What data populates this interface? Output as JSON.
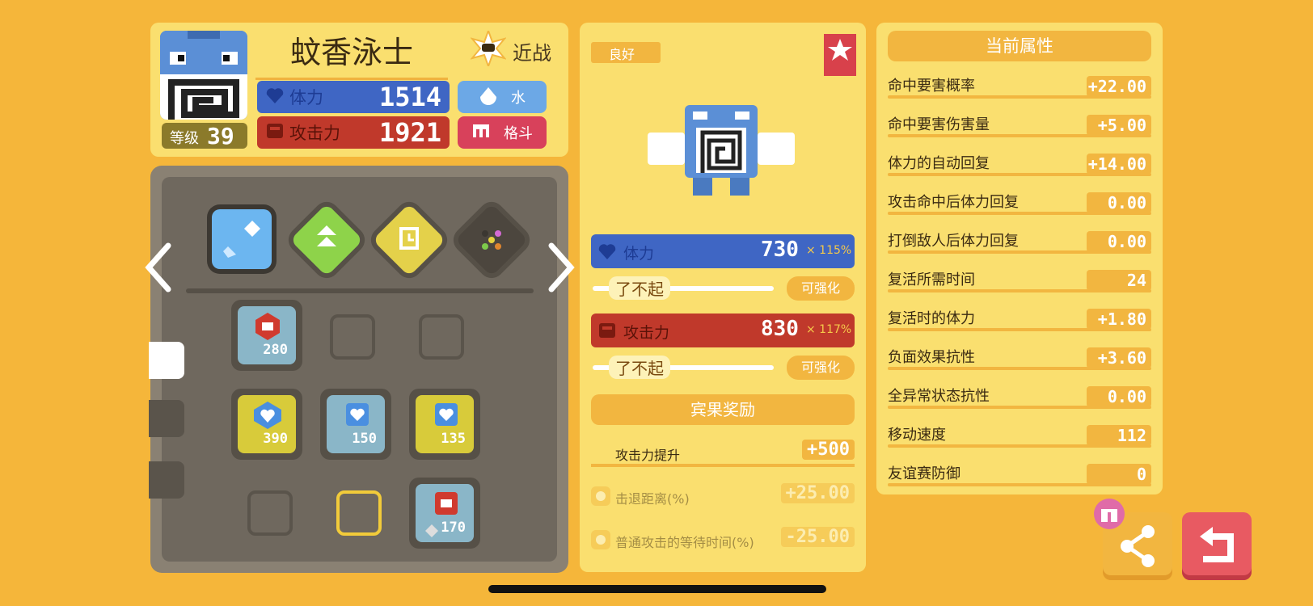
{
  "pokemon": {
    "name": "蚊香泳士",
    "level_label": "等级",
    "level": "39",
    "style_label": "近战",
    "hp_label": "体力",
    "hp_value": "1514",
    "atk_label": "攻击力",
    "atk_value": "1921",
    "types": [
      "水",
      "格斗"
    ]
  },
  "board": {
    "slots": [
      {
        "value": "280"
      },
      {
        "value": "390"
      },
      {
        "value": "150"
      },
      {
        "value": "135"
      },
      {
        "value": "170"
      }
    ]
  },
  "detail": {
    "quality_badge": "良好",
    "hp_label": "体力",
    "hp_value": "730",
    "hp_mult": "× 115%",
    "hp_grade": "了不起",
    "hp_upgrade": "可强化",
    "atk_label": "攻击力",
    "atk_value": "830",
    "atk_mult": "× 117%",
    "atk_grade": "了不起",
    "atk_upgrade": "可强化",
    "bonus_header": "宾果奖励",
    "bonus_rows": [
      {
        "label": "攻击力提升",
        "value": "+500",
        "active": true
      },
      {
        "label": "击退距离(%)",
        "value": "+25.00",
        "active": false
      },
      {
        "label": "普通攻击的等待时间(%)",
        "value": "-25.00",
        "active": false
      }
    ]
  },
  "attributes": {
    "header": "当前属性",
    "rows": [
      {
        "label": "命中要害概率",
        "value": "+22.00"
      },
      {
        "label": "命中要害伤害量",
        "value": "+5.00"
      },
      {
        "label": "体力的自动回复",
        "value": "+14.00"
      },
      {
        "label": "攻击命中后体力回复",
        "value": "0.00"
      },
      {
        "label": "打倒敌人后体力回复",
        "value": "0.00"
      },
      {
        "label": "复活所需时间",
        "value": "24"
      },
      {
        "label": "复活时的体力",
        "value": "+1.80"
      },
      {
        "label": "负面效果抗性",
        "value": "+3.60"
      },
      {
        "label": "全异常状态抗性",
        "value": "0.00"
      },
      {
        "label": "移动速度",
        "value": "112"
      },
      {
        "label": "友谊赛防御",
        "value": "0"
      }
    ]
  },
  "colors": {
    "background": "#F5B63A",
    "panel": "#FADF6F",
    "hp_blue": "#3F66C4",
    "atk_red": "#C0392B",
    "water": "#6CA8E6",
    "fighting": "#D8415B",
    "accent_orange": "#F2B640"
  }
}
